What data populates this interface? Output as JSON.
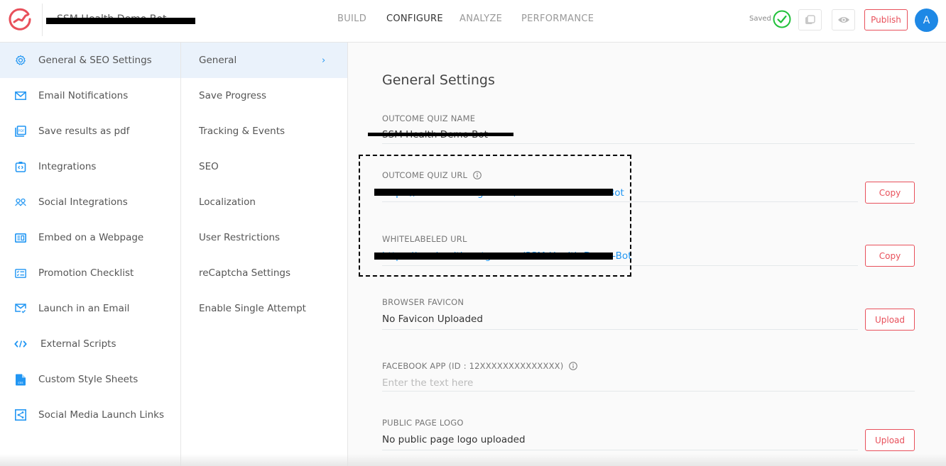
{
  "header": {
    "quiz_title": "SSM Health Demo Bot",
    "nav": [
      {
        "label": "BUILD",
        "active": false
      },
      {
        "label": "CONFIGURE",
        "active": true
      },
      {
        "label": "ANALYZE",
        "active": false
      },
      {
        "label": "PERFORMANCE",
        "active": false
      }
    ],
    "saved_label": "Saved",
    "publish_label": "Publish",
    "avatar_initial": "A",
    "colors": {
      "brand": "#e8505b",
      "accent": "#2196f3",
      "saved": "#21c13a",
      "avatar": "#1e88e5"
    }
  },
  "sidebar": {
    "items": [
      {
        "label": "General & SEO Settings",
        "icon": "gear-icon",
        "active": true
      },
      {
        "label": "Email Notifications",
        "icon": "mail-icon",
        "active": false
      },
      {
        "label": "Save results as pdf",
        "icon": "pdf-icon",
        "active": false
      },
      {
        "label": "Integrations",
        "icon": "integrations-icon",
        "active": false
      },
      {
        "label": "Social Integrations",
        "icon": "users-icon",
        "active": false
      },
      {
        "label": "Embed on a Webpage",
        "icon": "embed-icon",
        "active": false
      },
      {
        "label": "Promotion Checklist",
        "icon": "checklist-icon",
        "active": false
      },
      {
        "label": "Launch in an Email",
        "icon": "mail-check-icon",
        "active": false
      },
      {
        "label": "External Scripts",
        "icon": "code-icon",
        "active": false
      },
      {
        "label": "Custom Style Sheets",
        "icon": "css-file-icon",
        "active": false
      },
      {
        "label": "Social Media Launch Links",
        "icon": "share-icon",
        "active": false
      }
    ]
  },
  "subnav": {
    "items": [
      {
        "label": "General",
        "active": true
      },
      {
        "label": "Save Progress",
        "active": false
      },
      {
        "label": "Tracking & Events",
        "active": false
      },
      {
        "label": "SEO",
        "active": false
      },
      {
        "label": "Localization",
        "active": false
      },
      {
        "label": "User Restrictions",
        "active": false
      },
      {
        "label": "reCaptcha Settings",
        "active": false
      },
      {
        "label": "Enable Single Attempt",
        "active": false
      }
    ]
  },
  "main": {
    "title": "General Settings",
    "fields": {
      "quiz_name": {
        "label": "OUTCOME QUIZ NAME",
        "value": "SSM Health Demo Bot"
      },
      "quiz_url": {
        "label": "OUTCOME QUIZ URL",
        "value": "https://outcome.outgrow.us/SSM-Health-Demo-Bot",
        "button": "Copy"
      },
      "whitelabeled_url": {
        "label": "WHITELABELED URL",
        "value": "https://ssmhealth.outgrow.us/SSM-Health-Demo-Bot",
        "button": "Copy"
      },
      "favicon": {
        "label": "BROWSER FAVICON",
        "value": "No Favicon Uploaded",
        "button": "Upload"
      },
      "facebook_app": {
        "label": "FACEBOOK APP (ID : 12XXXXXXXXXXXXXX)",
        "value": "",
        "placeholder": "Enter the text here"
      },
      "public_logo": {
        "label": "PUBLIC PAGE LOGO",
        "value": "No public page logo uploaded",
        "button": "Upload"
      }
    }
  }
}
